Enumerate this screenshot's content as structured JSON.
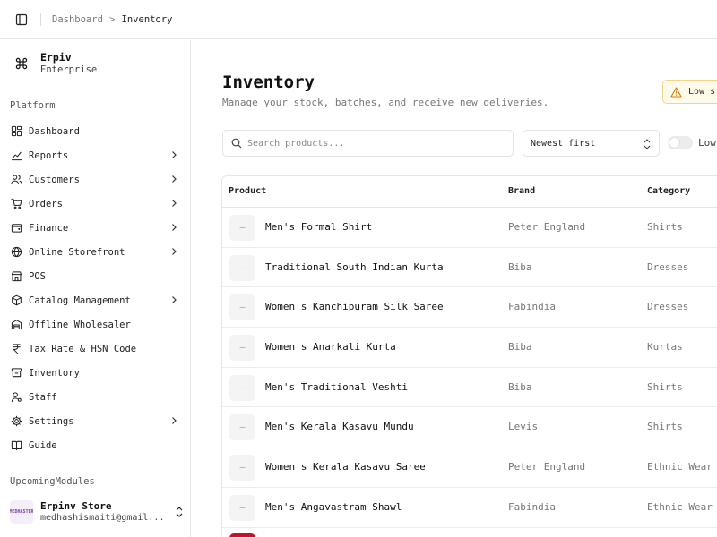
{
  "breadcrumb": {
    "parent": "Dashboard",
    "current": "Inventory",
    "separator": ">"
  },
  "workspace": {
    "name": "Erpiv",
    "plan": "Enterprise"
  },
  "sidebar": {
    "section_platform": "Platform",
    "items": [
      {
        "label": "Dashboard",
        "icon": "dashboard-icon",
        "has_chevron": false
      },
      {
        "label": "Reports",
        "icon": "chart-icon",
        "has_chevron": true
      },
      {
        "label": "Customers",
        "icon": "users-icon",
        "has_chevron": true
      },
      {
        "label": "Orders",
        "icon": "cart-icon",
        "has_chevron": true
      },
      {
        "label": "Finance",
        "icon": "wallet-icon",
        "has_chevron": true
      },
      {
        "label": "Online Storefront",
        "icon": "globe-icon",
        "has_chevron": true
      },
      {
        "label": "POS",
        "icon": "store-icon",
        "has_chevron": false
      },
      {
        "label": "Catalog Management",
        "icon": "package-icon",
        "has_chevron": true
      },
      {
        "label": "Offline Wholesaler",
        "icon": "warehouse-icon",
        "has_chevron": false
      },
      {
        "label": "Tax Rate & HSN Code",
        "icon": "rupee-icon",
        "has_chevron": false
      },
      {
        "label": "Inventory",
        "icon": "archive-icon",
        "has_chevron": false
      },
      {
        "label": "Staff",
        "icon": "staff-icon",
        "has_chevron": false
      },
      {
        "label": "Settings",
        "icon": "gear-icon",
        "has_chevron": true
      },
      {
        "label": "Guide",
        "icon": "book-icon",
        "has_chevron": false
      }
    ],
    "section_upcoming": "UpcomingModules",
    "store": {
      "name": "Erpinv Store",
      "email": "medhashismaiti@gmail...",
      "avatar_text": "MEDHASTER"
    }
  },
  "page": {
    "title": "Inventory",
    "subtitle": "Manage your stock, batches, and receive new deliveries.",
    "alert_label": "Low s"
  },
  "filters": {
    "search_placeholder": "Search products...",
    "sort_value": "Newest first",
    "toggle_label": "Low"
  },
  "table": {
    "columns": [
      "Product",
      "Brand",
      "Category"
    ],
    "rows": [
      {
        "product": "Men's Formal Shirt",
        "brand": "Peter England",
        "category": "Shirts"
      },
      {
        "product": "Traditional South Indian Kurta",
        "brand": "Biba",
        "category": "Dresses"
      },
      {
        "product": "Women's Kanchipuram Silk Saree",
        "brand": "Fabindia",
        "category": "Dresses"
      },
      {
        "product": "Women's Anarkali Kurta",
        "brand": "Biba",
        "category": "Kurtas"
      },
      {
        "product": "Men's Traditional Veshti",
        "brand": "Biba",
        "category": "Shirts"
      },
      {
        "product": "Men's Kerala Kasavu Mundu",
        "brand": "Levis",
        "category": "Shirts"
      },
      {
        "product": "Women's Kerala Kasavu Saree",
        "brand": "Peter England",
        "category": "Ethnic Wear"
      },
      {
        "product": "Men's Angavastram Shawl",
        "brand": "Fabindia",
        "category": "Ethnic Wear"
      }
    ],
    "thumb_placeholder": "–"
  },
  "colors": {
    "alert_border": "#f1d48a",
    "alert_bg": "#fffbeb",
    "alert_icon": "#d97706",
    "cutoff_thumb": "#c8102e"
  }
}
